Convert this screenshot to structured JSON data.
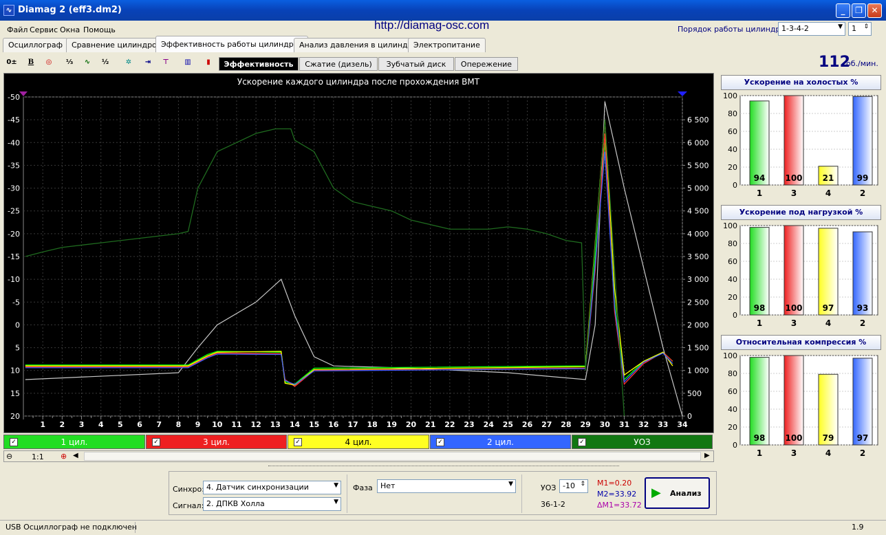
{
  "window": {
    "title": "Diamag 2 (eff3.dm2)"
  },
  "menu": [
    "Файл",
    "Сервис",
    "Окна",
    "Помощь"
  ],
  "url": "http://diamag-osc.com",
  "order": {
    "label": "Порядок работы цилиндров",
    "value": "1-3-4-2",
    "spin": "1"
  },
  "tabs": [
    "Осциллограф",
    "Сравнение цилиндров",
    "Эффективность работы цилиндров",
    "Анализ давления в цилиндре",
    "Электропитание"
  ],
  "active_tab": 2,
  "subtabs": [
    "Эффективность",
    "Сжатие (дизель)",
    "Зубчатый диск",
    "Опережение"
  ],
  "rpm": {
    "value": "112",
    "unit": "об./мин."
  },
  "chart_data": {
    "type": "line",
    "title": "Ускорение каждого цилиндра после прохождения ВМТ",
    "x_ticks": [
      "1",
      "2",
      "3",
      "4",
      "5",
      "6",
      "7",
      "8",
      "9",
      "10",
      "11",
      "12",
      "13",
      "14",
      "15",
      "16",
      "17",
      "18",
      "19",
      "20",
      "21",
      "22",
      "23",
      "24",
      "25",
      "26",
      "27",
      "28",
      "29",
      "30",
      "31",
      "32",
      "33",
      "34"
    ],
    "y_left_ticks": [
      "-50",
      "-45",
      "-40",
      "-35",
      "-30",
      "-25",
      "-20",
      "-15",
      "-10",
      "-5",
      "0",
      "5",
      "10",
      "15",
      "20"
    ],
    "y_right_ticks": [
      "6 500",
      "6 000",
      "5 500",
      "5 000",
      "4 500",
      "4 000",
      "3 500",
      "3 000",
      "2 500",
      "2 000",
      "1 500",
      "1 000",
      "500",
      "0"
    ],
    "ylim_left": [
      -50,
      20
    ],
    "ylim_right": [
      0,
      7000
    ],
    "series": [
      {
        "name": "1 цил.",
        "color": "#00ff00",
        "x": [
          0.1,
          8.5,
          9.5,
          10,
          13.3,
          13.5,
          14,
          15,
          29,
          29.5,
          30,
          30.5,
          31,
          32,
          33,
          33.5
        ],
        "y": [
          8.8,
          8.8,
          6.5,
          5.8,
          6,
          12.5,
          13,
          9.5,
          9,
          -15,
          -40,
          -5,
          12,
          8,
          6,
          8
        ]
      },
      {
        "name": "3 цил.",
        "color": "#ff3030",
        "x": [
          0.1,
          8.5,
          9.5,
          10,
          13.3,
          13.5,
          14,
          15,
          29,
          29.5,
          30,
          30.5,
          31,
          32,
          33,
          33.5
        ],
        "y": [
          9.2,
          9.2,
          7,
          6.2,
          6.3,
          12,
          13.5,
          10,
          9.5,
          -12,
          -42,
          -3,
          13,
          8.5,
          6,
          8
        ]
      },
      {
        "name": "4 цил.",
        "color": "#ffff00",
        "x": [
          0.1,
          8.5,
          9.5,
          10,
          13.3,
          13.5,
          14,
          15,
          29,
          29.5,
          30,
          30.5,
          31,
          32,
          33,
          33.5
        ],
        "y": [
          9,
          9,
          6.8,
          6,
          5.8,
          12.8,
          13.2,
          9.8,
          9.2,
          -18,
          -45,
          -8,
          11,
          8,
          6,
          9
        ]
      },
      {
        "name": "2 цил.",
        "color": "#4060ff",
        "x": [
          0.1,
          8.5,
          9.5,
          10,
          13.3,
          13.5,
          14,
          15,
          29,
          29.5,
          30,
          30.5,
          31,
          32,
          33,
          33.5
        ],
        "y": [
          9.4,
          9.4,
          7.2,
          6.4,
          6.5,
          12.2,
          13.1,
          10.1,
          9.6,
          -13,
          -38,
          -4,
          12.5,
          8.2,
          6.2,
          8.5
        ]
      },
      {
        "name": "УОЗ",
        "color": "#1f6b1f",
        "x": [
          0.1,
          1,
          2,
          4,
          6,
          8,
          8.5,
          9,
          10,
          11,
          12,
          13,
          13.8,
          14,
          15,
          16,
          17,
          18,
          19,
          20,
          21,
          22,
          24,
          25,
          26,
          27,
          28,
          28.8,
          29,
          30,
          31
        ],
        "y": [
          3500,
          3600,
          3700,
          3800,
          3900,
          4000,
          4050,
          5000,
          5800,
          6000,
          6200,
          6300,
          6300,
          6050,
          5800,
          5000,
          4700,
          4600,
          4500,
          4300,
          4200,
          4100,
          4100,
          4150,
          4100,
          4000,
          3850,
          3800,
          1000,
          6500,
          0
        ]
      }
    ],
    "white_line": {
      "color": "#c8c8c8",
      "x": [
        0.1,
        8,
        9,
        10,
        12,
        13.3,
        14,
        15,
        16,
        20,
        25,
        29,
        29.5,
        30,
        31,
        33,
        34
      ],
      "y": [
        800,
        950,
        1500,
        2000,
        2500,
        3000,
        2200,
        1300,
        1100,
        1050,
        950,
        800,
        2000,
        6900,
        5000,
        1500,
        0
      ]
    }
  },
  "legend": [
    {
      "label": "1 цил.",
      "color": "#22dd22"
    },
    {
      "label": "3 цил.",
      "color": "#ee2020"
    },
    {
      "label": "4 цил.",
      "color": "#ffff22"
    },
    {
      "label": "2 цил.",
      "color": "#3366ff"
    },
    {
      "label": "УОЗ",
      "color": "#117711"
    }
  ],
  "zoom": "1:1",
  "right_panels": [
    {
      "title": "Ускорение на холостых %",
      "categories": [
        "1",
        "3",
        "4",
        "2"
      ],
      "values": [
        94,
        100,
        21,
        99
      ]
    },
    {
      "title": "Ускорение под нагрузкой %",
      "categories": [
        "1",
        "3",
        "4",
        "2"
      ],
      "values": [
        98,
        100,
        97,
        93
      ]
    },
    {
      "title": "Относительная компрессия %",
      "categories": [
        "1",
        "3",
        "4",
        "2"
      ],
      "values": [
        98,
        100,
        79,
        97
      ]
    }
  ],
  "bar_axis": [
    "100",
    "80",
    "60",
    "40",
    "20",
    "0"
  ],
  "bar_colors": [
    "#22dd22",
    "#ee2020",
    "#ffff22",
    "#3366ff"
  ],
  "controls": {
    "sync_label": "Синхро:",
    "sync_value": "4.  Датчик синхронизации",
    "signal_label": "Сигнал:",
    "signal_value": "2.  ДПКВ Холла",
    "phase_label": "Фаза",
    "phase_value": "Нет",
    "uoz_label": "УОЗ",
    "uoz_value": "-10",
    "tooth": "36-1-2",
    "m1": "M1=0.20",
    "m2": "M2=33.92",
    "dm1": "ΔM1=33.72",
    "analyze": "Анализ"
  },
  "status": {
    "left": "USB Осциллограф не подключен",
    "right": "1.9"
  }
}
